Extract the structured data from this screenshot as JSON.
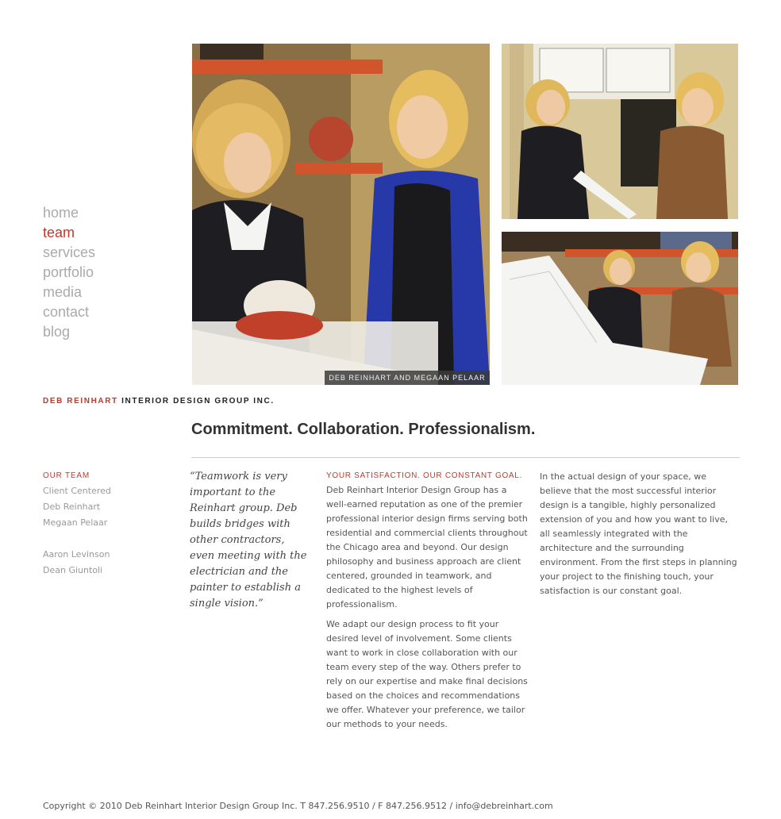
{
  "nav": {
    "items": [
      {
        "label": "home",
        "active": false
      },
      {
        "label": "team",
        "active": true
      },
      {
        "label": "services",
        "active": false
      },
      {
        "label": "portfolio",
        "active": false
      },
      {
        "label": "media",
        "active": false
      },
      {
        "label": "contact",
        "active": false
      },
      {
        "label": "blog",
        "active": false
      }
    ]
  },
  "photos": {
    "main_caption": "DEB REINHART AND MEGAAN PELAAR"
  },
  "brand": {
    "name_part": "DEB REINHART",
    "company_part": "INTERIOR DESIGN GROUP INC."
  },
  "headline": "Commitment. Collaboration. Professionalism.",
  "subnav": {
    "heading": "OUR TEAM",
    "group1": [
      "Client Centered",
      "Deb Reinhart",
      "Megaan Pelaar"
    ],
    "group2": [
      "Aaron Levinson",
      "Dean Giuntoli"
    ]
  },
  "quote": "“Teamwork is very important to the Reinhart group. Deb builds bridges with other contractors, even meeting with the electrician and the painter to establish a single vision.”",
  "middle_column": {
    "heading": "YOUR SATISFACTION. OUR CONSTANT GOAL.",
    "paragraph1": "Deb Reinhart Interior Design Group has a well-earned reputation as one of the premier professional interior design firms serving both residential and commercial clients throughout the Chicago area and beyond. Our design philosophy and business approach are client centered, grounded in teamwork, and dedicated to the highest levels of professionalism.",
    "paragraph2": "We adapt our design process to fit your desired level of involvement. Some clients want to work in close collaboration with our team every step of the way. Others prefer to rely on our expertise and make final decisions based on the choices and recommendations we offer. Whatever your preference, we tailor our methods to your needs."
  },
  "right_column": {
    "paragraph": "In the actual design of your space, we believe that the most successful interior design is a tangible, highly personalized extension of you and how you want to live, all seamlessly integrated with the architecture and the surrounding environment. From the first steps in planning your project to the finishing touch, your satisfaction is our constant goal."
  },
  "footer": {
    "text": "Copyright © 2010 Deb Reinhart Interior Design Group Inc. T 847.256.9510 / F 847.256.9512 / ",
    "email": "info@debreinhart.com"
  },
  "colors": {
    "accent": "#c0392b",
    "nav_inactive": "#aaaaaa"
  }
}
